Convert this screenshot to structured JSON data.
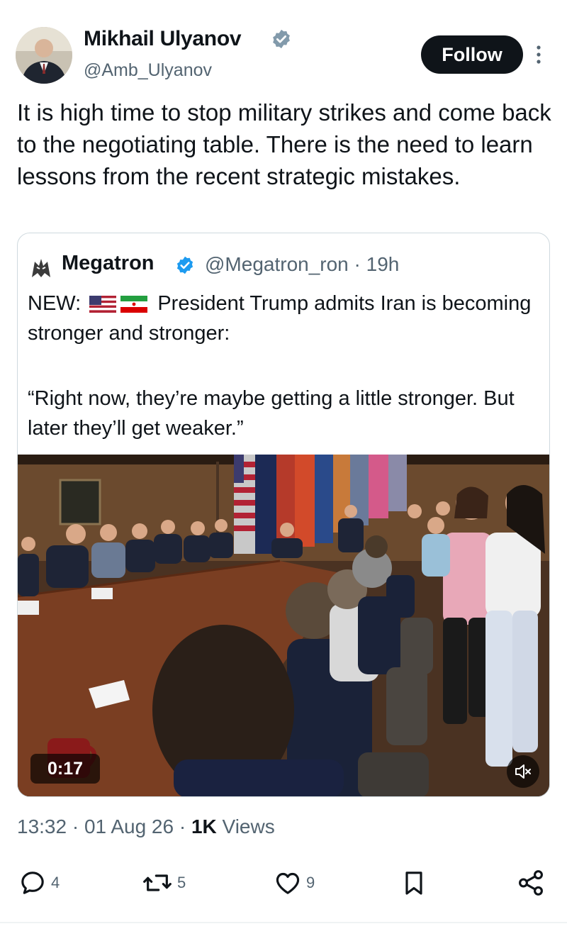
{
  "author": {
    "name": "Mikhail Ulyanov",
    "handle": "@Amb_Ulyanov",
    "verified_icon": "verified-badge-gray"
  },
  "follow_label": "Follow",
  "tweet_text": "It is high time to stop military strikes and come back to the negotiating table. There is the need to learn lessons from the recent strategic mistakes.",
  "quoted": {
    "name": "Megatron",
    "handle": "@Megatron_ron · 19h",
    "verified_icon": "verified-badge-blue",
    "text_prefix": "NEW:",
    "flags_icon": "us-iran-flags",
    "text_main": "President Trump admits Iran is becoming stronger and stronger:",
    "quote": "“Right now, they’re maybe getting a little stronger. But later they’ll get weaker.”",
    "video_duration": "0:17"
  },
  "meta": {
    "datetime": "13:32 · 01 Aug 26 · ",
    "views_count": "1K",
    "views_label": " Views"
  },
  "actions": {
    "replies": "4",
    "reposts": "5",
    "likes": "9"
  },
  "colors": {
    "accent_blue": "#1d9bf0",
    "text_primary": "#0f1419",
    "text_secondary": "#536471",
    "verified_gray": "#829aab"
  }
}
